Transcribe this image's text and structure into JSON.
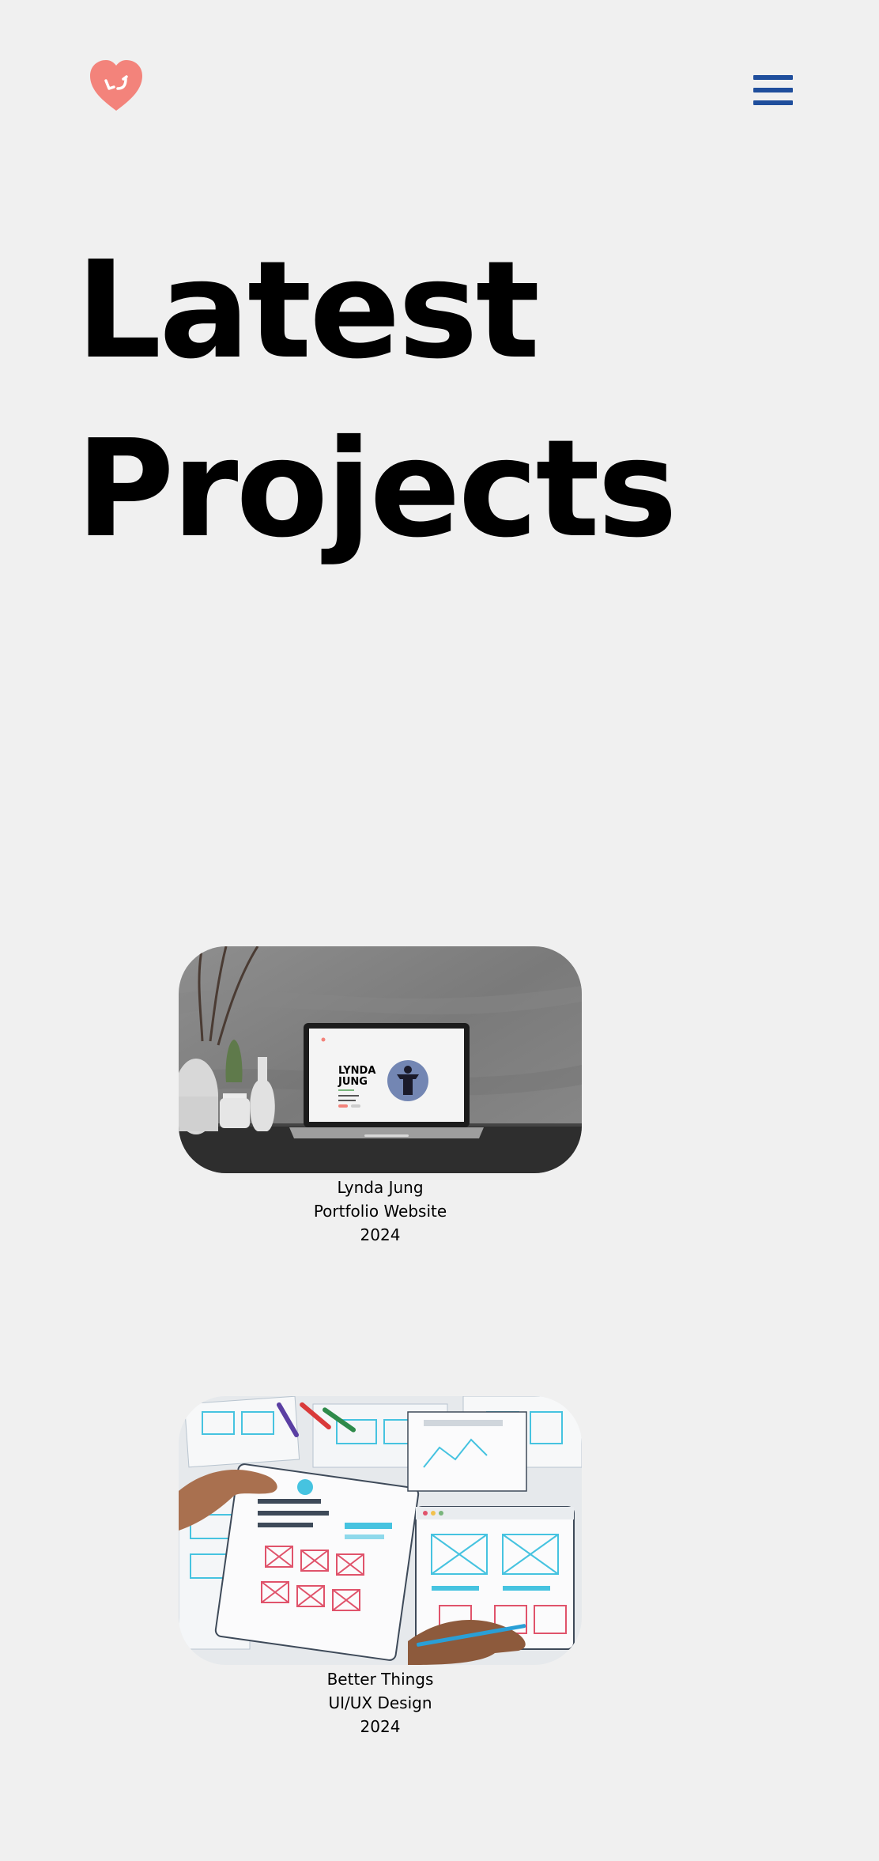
{
  "header": {
    "logo_icon": "heart-logo-icon",
    "logo_color": "#f3837b",
    "menu_icon": "hamburger-menu-icon",
    "menu_color": "#1f4e9c"
  },
  "hero": {
    "title_line1": "Latest",
    "title_line2": "Projects"
  },
  "projects": [
    {
      "image_label_line1": "LYNDA",
      "image_label_line2": "JUNG",
      "title": "Lynda Jung",
      "subtitle": "Portfolio Website",
      "year": "2024"
    },
    {
      "title": "Better Things",
      "subtitle": "UI/UX Design",
      "year": "2024"
    }
  ]
}
